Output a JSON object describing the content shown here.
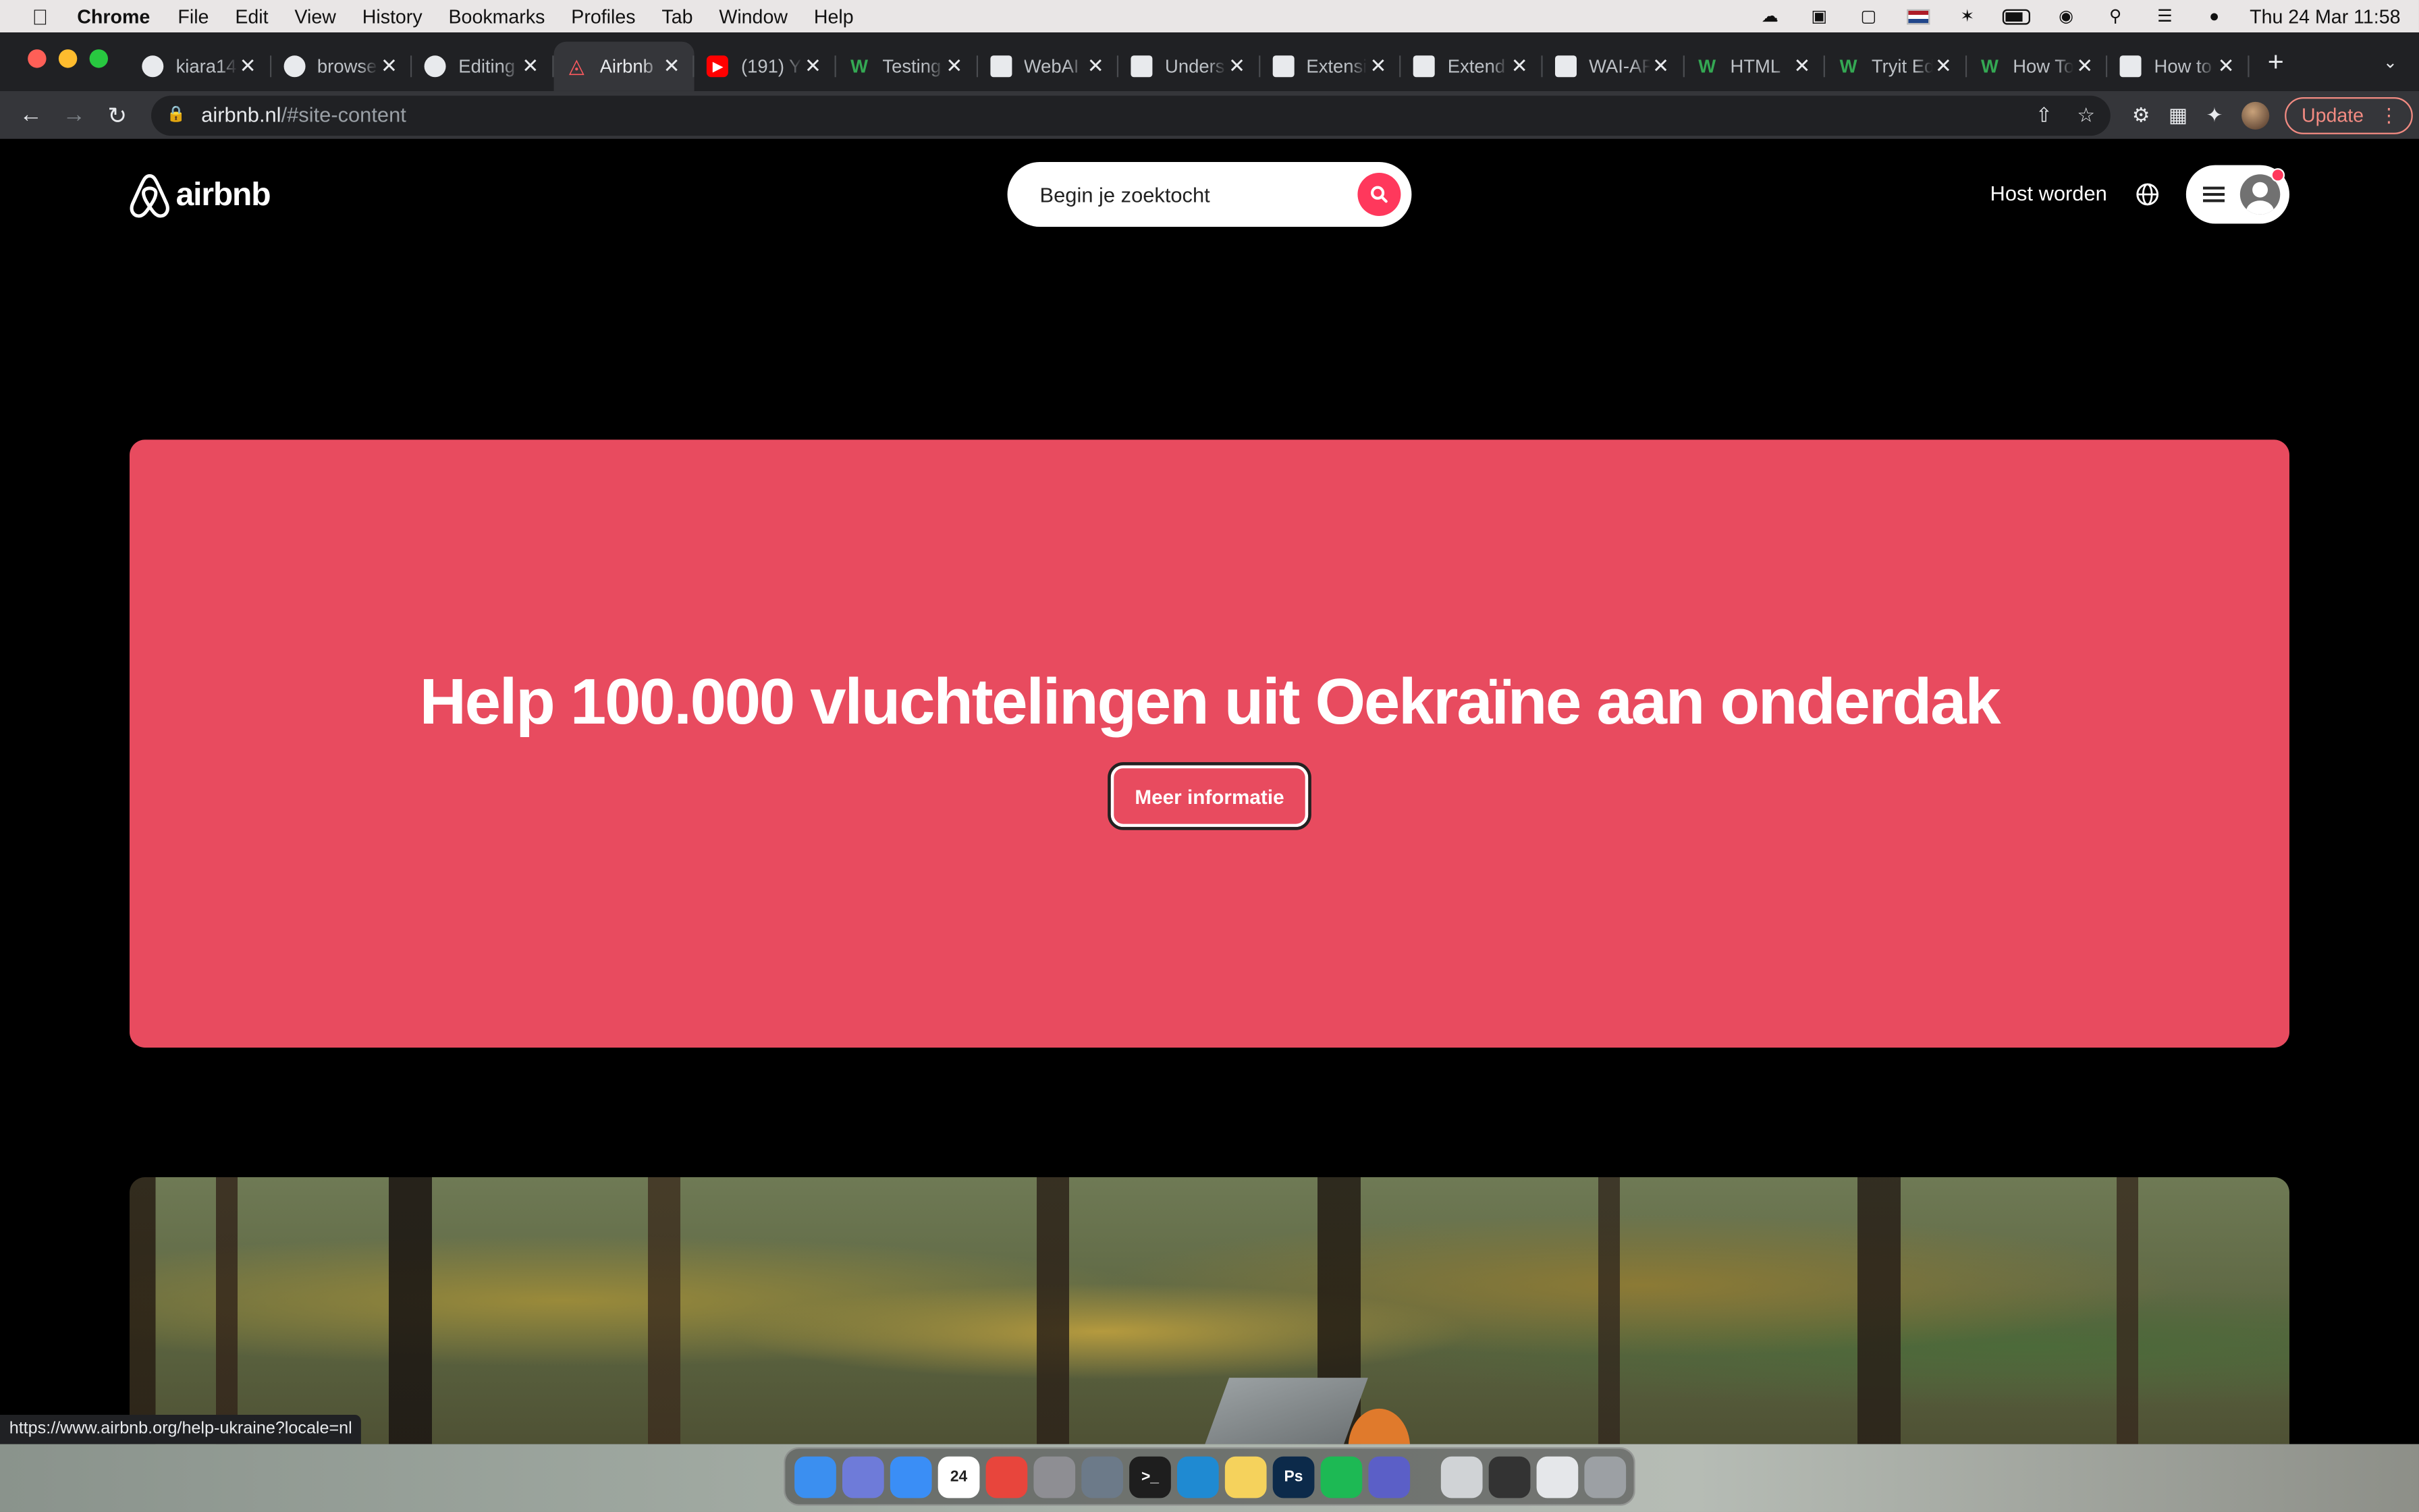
{
  "menubar": {
    "app": "Chrome",
    "items": [
      "File",
      "Edit",
      "View",
      "History",
      "Bookmarks",
      "Profiles",
      "Tab",
      "Window",
      "Help"
    ],
    "clock": "Thu 24 Mar  11:58"
  },
  "tabs": [
    {
      "title": "kiara14",
      "icon": "github-icon",
      "fav": "gh"
    },
    {
      "title": "browse",
      "icon": "github-icon",
      "fav": "gh"
    },
    {
      "title": "Editing",
      "icon": "github-icon",
      "fav": "gh"
    },
    {
      "title": "Airbnb",
      "icon": "airbnb-icon",
      "fav": "ab",
      "active": true
    },
    {
      "title": "(191) Y",
      "icon": "youtube-icon",
      "fav": "yt"
    },
    {
      "title": "Testing",
      "icon": "aa-icon",
      "fav": "gr"
    },
    {
      "title": "WebAI",
      "icon": "gear-icon",
      "fav": "sq"
    },
    {
      "title": "Unders",
      "icon": "w3-icon",
      "fav": "sq"
    },
    {
      "title": "Extensi",
      "icon": "puzzle-icon",
      "fav": "sq"
    },
    {
      "title": "Extend",
      "icon": "page-icon",
      "fav": "sq"
    },
    {
      "title": "WAI-AF",
      "icon": "m-icon",
      "fav": "sq"
    },
    {
      "title": "HTML",
      "icon": "w-icon",
      "fav": "gr"
    },
    {
      "title": "Tryit Ed",
      "icon": "w-icon",
      "fav": "gr"
    },
    {
      "title": "How To",
      "icon": "w-icon",
      "fav": "gr"
    },
    {
      "title": "How to",
      "icon": "globe-icon",
      "fav": "sq"
    }
  ],
  "toolbar": {
    "url_host": "airbnb.nl",
    "url_path": "/#site-content",
    "update_label": "Update"
  },
  "header": {
    "logo_text": "airbnb",
    "search_placeholder": "Begin je zoektocht",
    "host_link": "Host worden"
  },
  "banner": {
    "title": "Help 100.000 vluchtelingen uit Oekraïne aan onderdak",
    "cta": "Meer informatie",
    "background": "#e84b5f"
  },
  "status_url": "https://www.airbnb.org/help-ukraine?locale=nl",
  "dock": {
    "items": [
      {
        "name": "finder",
        "color": "#3b8ff0",
        "label": ""
      },
      {
        "name": "launchpad",
        "color": "#6e7bd9",
        "label": ""
      },
      {
        "name": "mail",
        "color": "#3a8ef6",
        "label": ""
      },
      {
        "name": "calendar",
        "color": "#ffffff",
        "label": "24"
      },
      {
        "name": "chrome",
        "color": "#e8453c",
        "label": ""
      },
      {
        "name": "system-preferences",
        "color": "#8e8e93",
        "label": ""
      },
      {
        "name": "preview",
        "color": "#6c7a89",
        "label": ""
      },
      {
        "name": "terminal",
        "color": "#1e1e1e",
        "label": ">_"
      },
      {
        "name": "vscode",
        "color": "#1f8ad2",
        "label": ""
      },
      {
        "name": "notes",
        "color": "#f5d25c",
        "label": ""
      },
      {
        "name": "photoshop",
        "color": "#0c2a4a",
        "label": "Ps"
      },
      {
        "name": "spotify",
        "color": "#1db954",
        "label": ""
      },
      {
        "name": "teams",
        "color": "#5b5fc7",
        "label": ""
      },
      {
        "name": "downloads",
        "color": "#d0d3d6",
        "label": ""
      },
      {
        "name": "screenshot",
        "color": "#333333",
        "label": ""
      },
      {
        "name": "folder",
        "color": "#e5e7ea",
        "label": ""
      },
      {
        "name": "trash",
        "color": "#9ca0a4",
        "label": ""
      }
    ]
  }
}
